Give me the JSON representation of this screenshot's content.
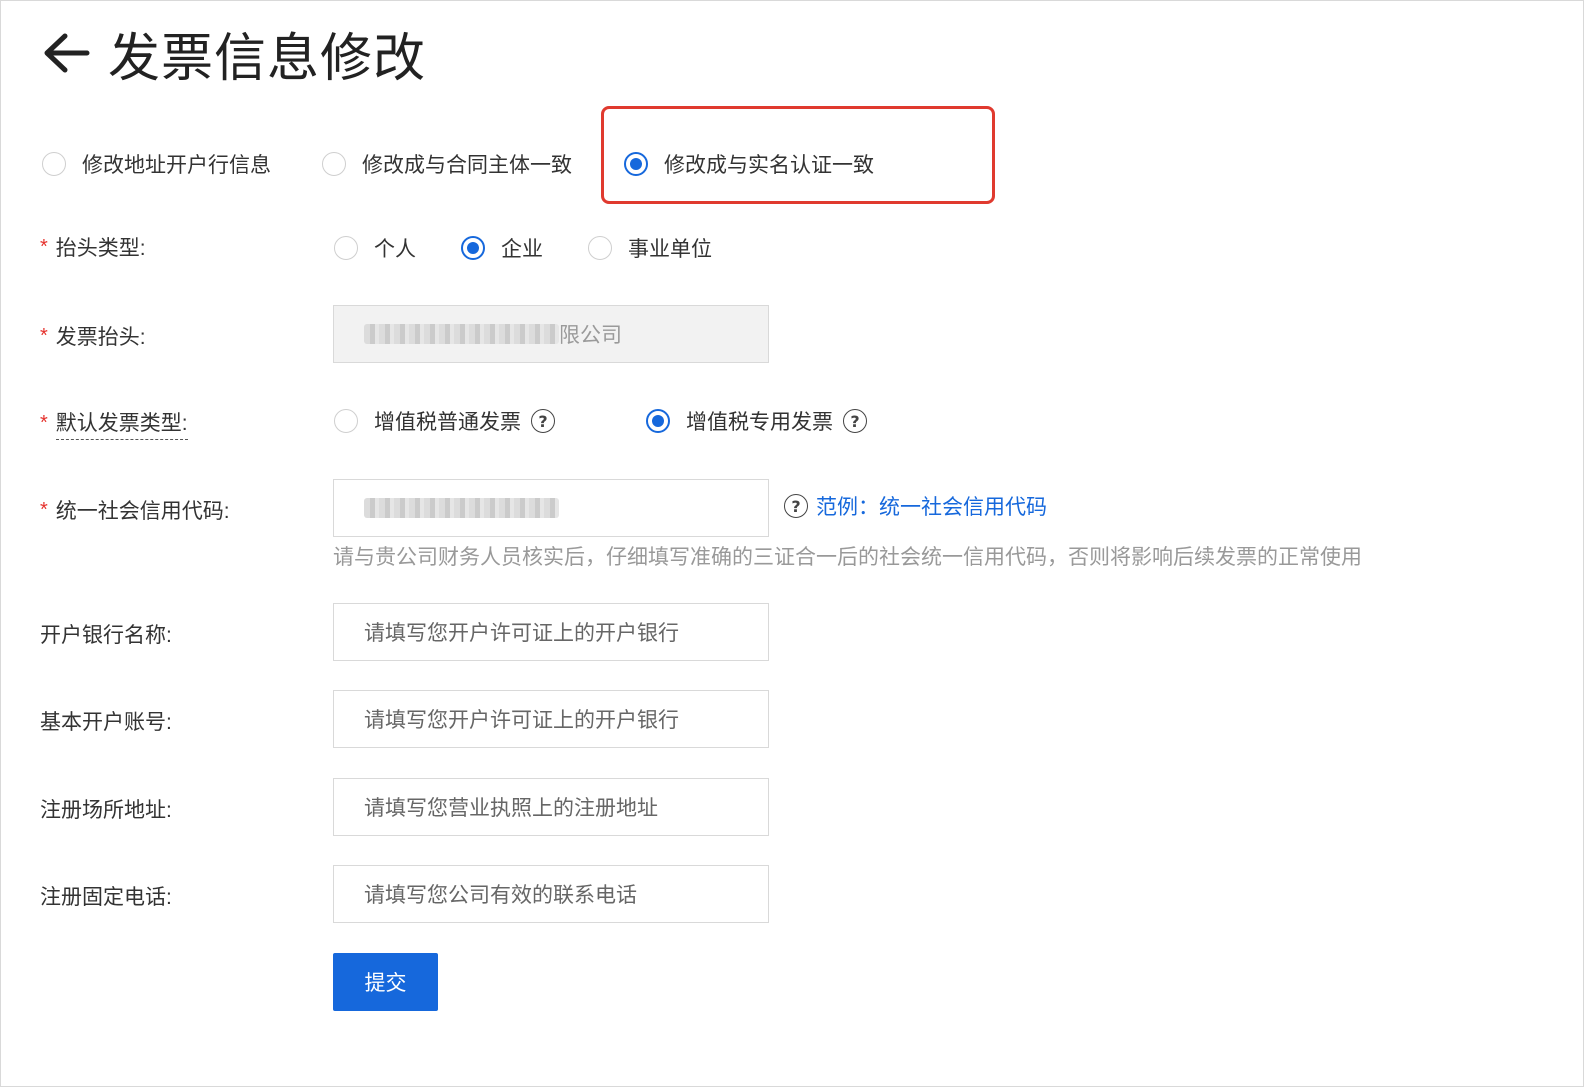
{
  "header": {
    "title": "发票信息修改"
  },
  "modify_mode": {
    "options": [
      {
        "label": "修改地址开户行信息",
        "checked": false
      },
      {
        "label": "修改成与合同主体一致",
        "checked": false
      },
      {
        "label": "修改成与实名认证一致",
        "checked": true
      }
    ]
  },
  "form": {
    "header_type": {
      "label": "抬头类型:",
      "required": "*",
      "options": [
        {
          "label": "个人",
          "checked": false
        },
        {
          "label": "企业",
          "checked": true
        },
        {
          "label": "事业单位",
          "checked": false
        }
      ]
    },
    "invoice_header": {
      "label": "发票抬头:",
      "required": "*",
      "value_suffix": "限公司"
    },
    "default_invoice_type": {
      "label": "默认发票类型:",
      "required": "*",
      "options": [
        {
          "label": "增值税普通发票",
          "checked": false
        },
        {
          "label": "增值税专用发票",
          "checked": true
        }
      ]
    },
    "credit_code": {
      "label": "统一社会信用代码:",
      "required": "*",
      "example_link": "范例：统一社会信用代码",
      "hint": "请与贵公司财务人员核实后，仔细填写准确的三证合一后的社会统一信用代码，否则将影响后续发票的正常使用"
    },
    "bank_name": {
      "label": "开户银行名称:",
      "placeholder": "请填写您开户许可证上的开户银行"
    },
    "bank_account": {
      "label": "基本开户账号:",
      "placeholder": "请填写您开户许可证上的开户银行"
    },
    "reg_address": {
      "label": "注册场所地址:",
      "placeholder": "请填写您营业执照上的注册地址"
    },
    "reg_phone": {
      "label": "注册固定电话:",
      "placeholder": "请填写您公司有效的联系电话"
    },
    "submit_label": "提交"
  },
  "colors": {
    "primary": "#1668dc",
    "required": "#e5322d",
    "highlight_border": "#e03a2f"
  },
  "icons": [
    "back-arrow-icon",
    "help-icon"
  ]
}
